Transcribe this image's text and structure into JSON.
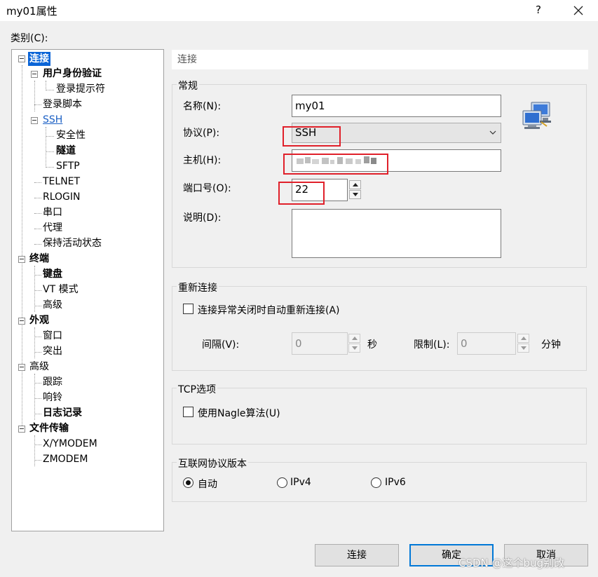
{
  "window": {
    "title": "my01属性",
    "help": "?"
  },
  "category_label": "类别(C):",
  "tree": [
    {
      "label": "连接"
    },
    {
      "label": "用户身份验证"
    },
    {
      "label": "登录提示符"
    },
    {
      "label": "登录脚本"
    },
    {
      "label": "SSH"
    },
    {
      "label": "安全性"
    },
    {
      "label": "隧道"
    },
    {
      "label": "SFTP"
    },
    {
      "label": "TELNET"
    },
    {
      "label": "RLOGIN"
    },
    {
      "label": "串口"
    },
    {
      "label": "代理"
    },
    {
      "label": "保持活动状态"
    },
    {
      "label": "终端"
    },
    {
      "label": "键盘"
    },
    {
      "label": "VT 模式"
    },
    {
      "label": "高级"
    },
    {
      "label": "外观"
    },
    {
      "label": "窗口"
    },
    {
      "label": "突出"
    },
    {
      "label": "高级"
    },
    {
      "label": "跟踪"
    },
    {
      "label": "响铃"
    },
    {
      "label": "日志记录"
    },
    {
      "label": "文件传输"
    },
    {
      "label": "X/YMODEM"
    },
    {
      "label": "ZMODEM"
    }
  ],
  "page_header": "连接",
  "general": {
    "title": "常规",
    "name_label": "名称(N):",
    "name_value": "my01",
    "protocol_label": "协议(P):",
    "protocol_value": "SSH",
    "host_label": "主机(H):",
    "port_label": "端口号(O):",
    "port_value": "22",
    "desc_label": "说明(D):",
    "desc_value": ""
  },
  "reconnect": {
    "title": "重新连接",
    "checkbox_label": "连接异常关闭时自动重新连接(A)",
    "checked": false,
    "interval_label": "间隔(V):",
    "interval_value": "0",
    "seconds_unit": "秒",
    "limit_label": "限制(L):",
    "limit_value": "0",
    "minutes_unit": "分钟"
  },
  "tcp": {
    "title": "TCP选项",
    "nagle_label": "使用Nagle算法(U)",
    "checked": false
  },
  "ip_version": {
    "title": "互联网协议版本",
    "options": [
      {
        "label": "自动",
        "selected": true
      },
      {
        "label": "IPv4",
        "selected": false
      },
      {
        "label": "IPv6",
        "selected": false
      }
    ]
  },
  "buttons": {
    "connect": "连接",
    "ok": "确定",
    "cancel": "取消"
  },
  "watermark": "CSDN @这个bug别改",
  "colors": {
    "selection": "#0a64d7",
    "highlight_box": "#e0202a",
    "default_button_border": "#0078d7"
  }
}
